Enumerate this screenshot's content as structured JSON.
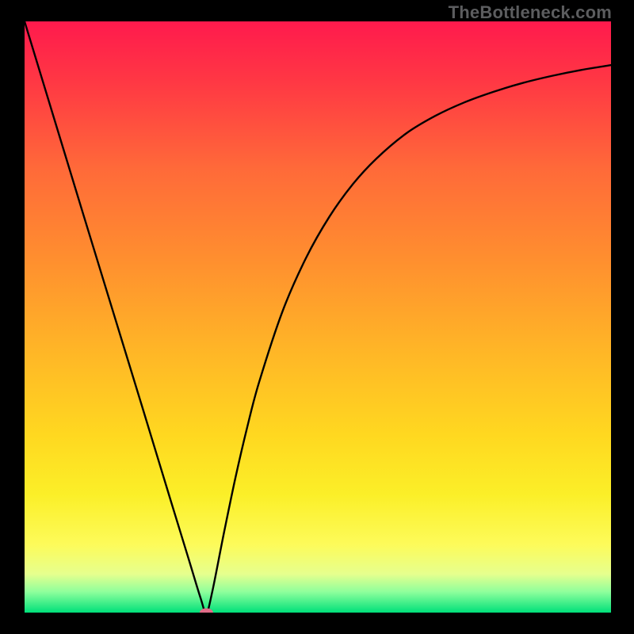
{
  "watermark": "TheBottleneck.com",
  "chart_data": {
    "type": "line",
    "title": "",
    "xlabel": "",
    "ylabel": "",
    "xlim": [
      0,
      100
    ],
    "ylim": [
      0,
      100
    ],
    "grid": false,
    "legend": false,
    "background": {
      "kind": "vertical-gradient",
      "stops": [
        {
          "t": 0.0,
          "color": "#ff1a4d"
        },
        {
          "t": 0.1,
          "color": "#ff3744"
        },
        {
          "t": 0.25,
          "color": "#ff6a39"
        },
        {
          "t": 0.4,
          "color": "#ff8e2f"
        },
        {
          "t": 0.55,
          "color": "#ffb427"
        },
        {
          "t": 0.7,
          "color": "#ffd820"
        },
        {
          "t": 0.8,
          "color": "#fbef28"
        },
        {
          "t": 0.885,
          "color": "#fdfb5a"
        },
        {
          "t": 0.935,
          "color": "#e6ff8e"
        },
        {
          "t": 0.965,
          "color": "#8eff9c"
        },
        {
          "t": 1.0,
          "color": "#00e07a"
        }
      ]
    },
    "series": [
      {
        "name": "bottleneck-curve",
        "x": [
          0,
          5,
          10,
          15,
          20,
          25,
          28,
          30,
          31,
          32,
          34,
          36,
          38,
          40,
          44,
          48,
          52,
          56,
          60,
          65,
          70,
          75,
          80,
          85,
          90,
          95,
          100
        ],
        "values": [
          100,
          83.7,
          67.4,
          51.2,
          35.0,
          18.7,
          9.0,
          2.5,
          0.0,
          3.5,
          13.5,
          23.0,
          31.5,
          39.0,
          51.0,
          60.0,
          67.0,
          72.5,
          76.8,
          81.0,
          84.0,
          86.3,
          88.1,
          89.6,
          90.8,
          91.8,
          92.6
        ]
      }
    ],
    "marker": {
      "name": "optimal-point",
      "x": 31,
      "y": 0,
      "color": "#e06c88",
      "shape": "pill"
    }
  },
  "colors": {
    "frame": "#000000",
    "curve": "#000000",
    "marker": "#e06c88"
  }
}
